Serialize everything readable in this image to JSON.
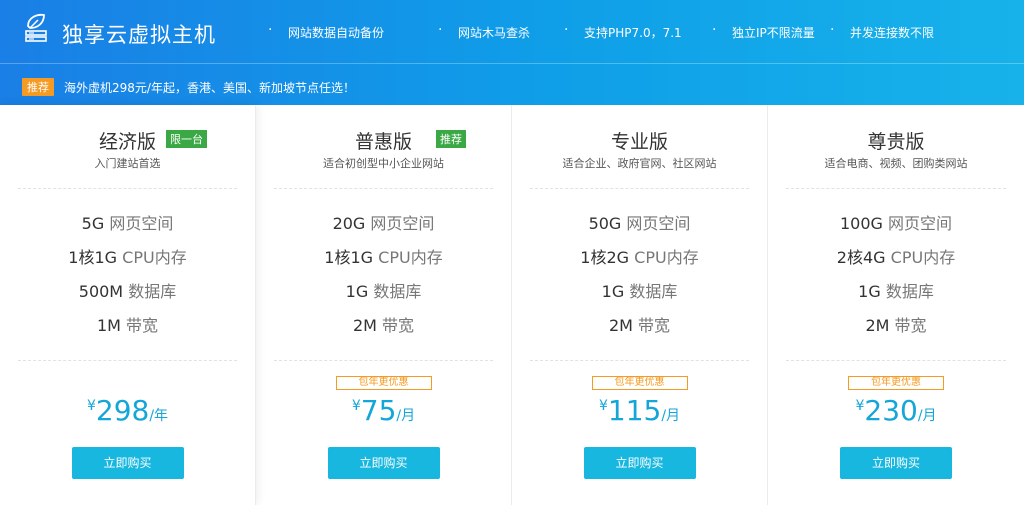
{
  "header": {
    "brand": "独享云虚拟主机",
    "features": [
      "网站数据自动备份",
      "网站木马查杀",
      "支持PHP7.0，7.1",
      "独立IP不限流量",
      "并发连接数不限"
    ],
    "promo_tag": "推荐",
    "promo_text": "海外虚机298元/年起，香港、美国、新加坡节点任选！"
  },
  "plans": [
    {
      "name": "经济版",
      "badge": "限一台",
      "subtitle": "入门建站首选",
      "specs": [
        {
          "value": "5G",
          "unit": "网页空间"
        },
        {
          "value": "1核1G",
          "unit": "CPU内存"
        },
        {
          "value": "500M",
          "unit": "数据库"
        },
        {
          "value": "1M",
          "unit": "带宽"
        }
      ],
      "discount": "",
      "currency": "¥",
      "price": "298",
      "period": "/年",
      "buy": "立即购买"
    },
    {
      "name": "普惠版",
      "badge": "推荐",
      "subtitle": "适合初创型中小企业网站",
      "specs": [
        {
          "value": "20G",
          "unit": "网页空间"
        },
        {
          "value": "1核1G",
          "unit": "CPU内存"
        },
        {
          "value": "1G",
          "unit": "数据库"
        },
        {
          "value": "2M",
          "unit": "带宽"
        }
      ],
      "discount": "包年更优惠",
      "currency": "¥",
      "price": "75",
      "period": "/月",
      "buy": "立即购买"
    },
    {
      "name": "专业版",
      "badge": "",
      "subtitle": "适合企业、政府官网、社区网站",
      "specs": [
        {
          "value": "50G",
          "unit": "网页空间"
        },
        {
          "value": "1核2G",
          "unit": "CPU内存"
        },
        {
          "value": "1G",
          "unit": "数据库"
        },
        {
          "value": "2M",
          "unit": "带宽"
        }
      ],
      "discount": "包年更优惠",
      "currency": "¥",
      "price": "115",
      "period": "/月",
      "buy": "立即购买"
    },
    {
      "name": "尊贵版",
      "badge": "",
      "subtitle": "适合电商、视频、团购类网站",
      "specs": [
        {
          "value": "100G",
          "unit": "网页空间"
        },
        {
          "value": "2核4G",
          "unit": "CPU内存"
        },
        {
          "value": "1G",
          "unit": "数据库"
        },
        {
          "value": "2M",
          "unit": "带宽"
        }
      ],
      "discount": "包年更优惠",
      "currency": "¥",
      "price": "230",
      "period": "/月",
      "buy": "立即购买"
    }
  ],
  "colors": {
    "accent": "#18b7df",
    "price": "#14a6d8",
    "discount": "#f59a23",
    "badge_green": "#3aa844",
    "promo_orange": "#f59a23"
  },
  "icons": {
    "logo": "leaf-server-logo-icon"
  }
}
